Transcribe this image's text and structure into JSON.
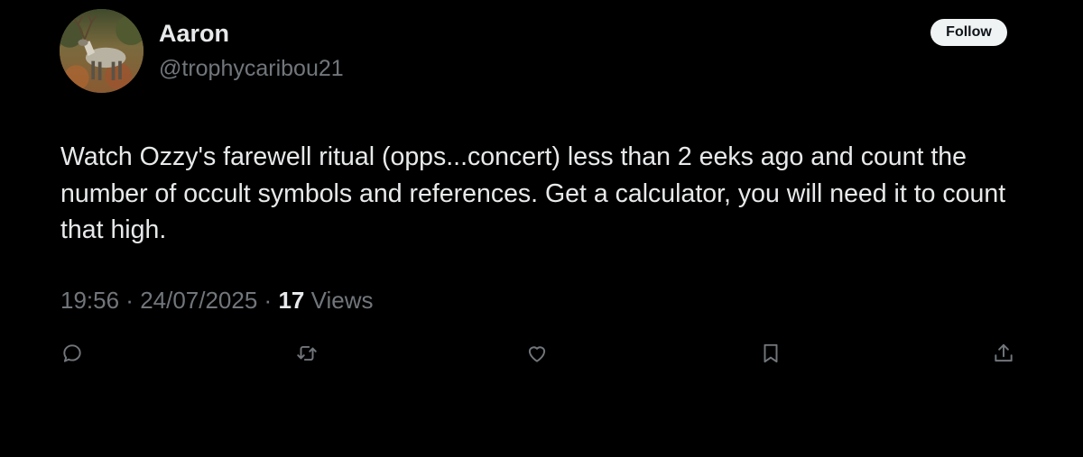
{
  "user": {
    "name": "Aaron",
    "handle": "@trophycaribou21",
    "avatar_icon": "caribou-avatar"
  },
  "follow_button": {
    "label": "Follow"
  },
  "tweet": {
    "text": "Watch Ozzy's farewell ritual (opps...concert) less than 2 eeks ago and count the number of occult symbols and references. Get a calculator, you will need it to count that high.",
    "time": "19:56",
    "separator": " · ",
    "date": "24/07/2025",
    "views_count": "17",
    "views_label": " Views"
  },
  "actions": [
    {
      "icon": "reply-icon"
    },
    {
      "icon": "retweet-icon"
    },
    {
      "icon": "like-icon"
    },
    {
      "icon": "bookmark-icon"
    },
    {
      "icon": "share-icon"
    }
  ],
  "colors": {
    "background": "#000000",
    "primary_text": "#e7e9ea",
    "secondary_text": "#71767b",
    "follow_bg": "#eff3f4",
    "follow_text": "#0f1419"
  }
}
